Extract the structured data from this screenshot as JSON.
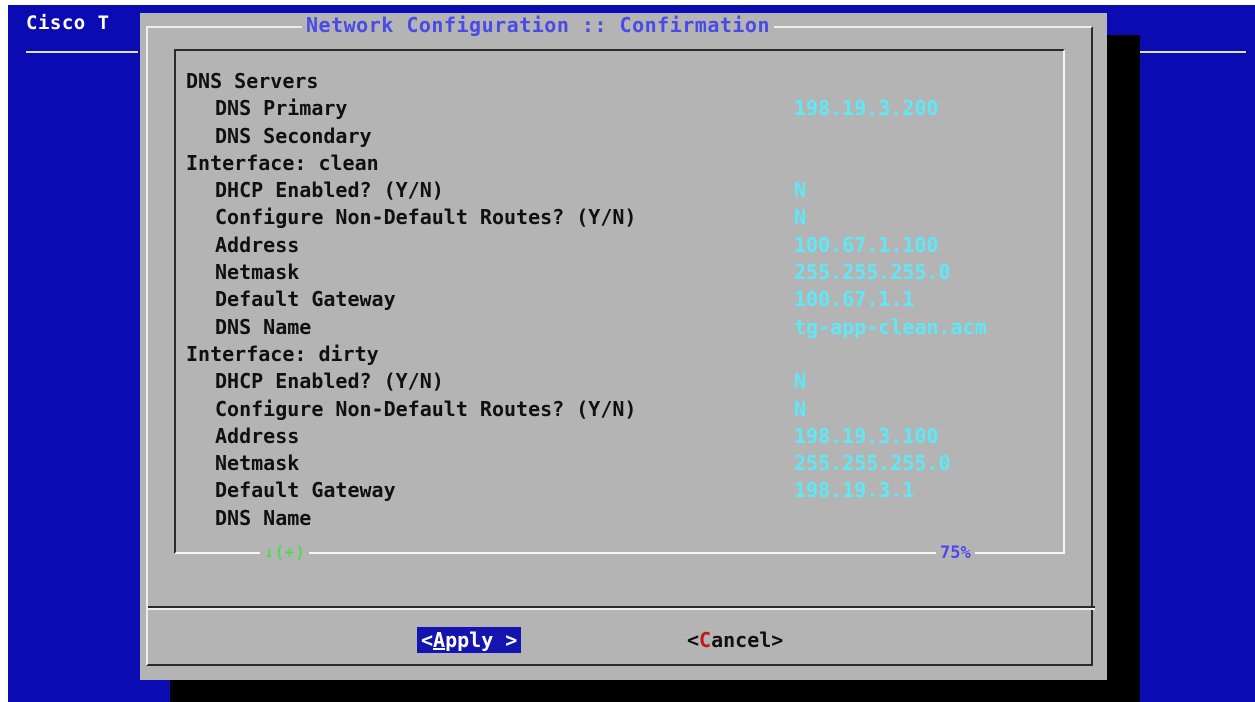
{
  "screen": {
    "backtitle": "Cisco T",
    "bg_fragment": "qq"
  },
  "dialog": {
    "title": "Network Configuration :: Confirmation",
    "rows": [
      {
        "label": "DNS Servers",
        "value": "",
        "indent": false
      },
      {
        "label": "DNS Primary",
        "value": "198.19.3.200",
        "indent": true
      },
      {
        "label": "DNS Secondary",
        "value": "",
        "indent": true
      },
      {
        "label": "Interface: clean",
        "value": "",
        "indent": false
      },
      {
        "label": "DHCP Enabled? (Y/N)",
        "value": "N",
        "indent": true
      },
      {
        "label": "Configure Non-Default Routes? (Y/N)",
        "value": "N",
        "indent": true
      },
      {
        "label": "Address",
        "value": "100.67.1.100",
        "indent": true
      },
      {
        "label": "Netmask",
        "value": "255.255.255.0",
        "indent": true
      },
      {
        "label": "Default Gateway",
        "value": "100.67.1.1",
        "indent": true
      },
      {
        "label": "DNS Name",
        "value": "tg-app-clean.acm",
        "indent": true
      },
      {
        "label": "Interface: dirty",
        "value": "",
        "indent": false
      },
      {
        "label": "DHCP Enabled? (Y/N)",
        "value": "N",
        "indent": true
      },
      {
        "label": "Configure Non-Default Routes? (Y/N)",
        "value": "N",
        "indent": true
      },
      {
        "label": "Address",
        "value": "198.19.3.100",
        "indent": true
      },
      {
        "label": "Netmask",
        "value": "255.255.255.0",
        "indent": true
      },
      {
        "label": "Default Gateway",
        "value": "198.19.3.1",
        "indent": true
      },
      {
        "label": "DNS Name",
        "value": "",
        "indent": true
      }
    ],
    "more_indicator": "↓(+)",
    "scroll_percent": "75%",
    "buttons": {
      "apply": {
        "open": "<",
        "hot": "A",
        "rest": "pply >"
      },
      "cancel": {
        "open": "<",
        "hot": "C",
        "rest": "ancel>"
      }
    }
  },
  "colors": {
    "screen_bg": "#0b0bb3",
    "dialog_bg": "#b4b4b4",
    "title": "#4a4ae8",
    "value": "#5fe8f5",
    "indicator": "#5ad45a",
    "selected_button": "#1414b0",
    "hotkey": "#c01818"
  }
}
